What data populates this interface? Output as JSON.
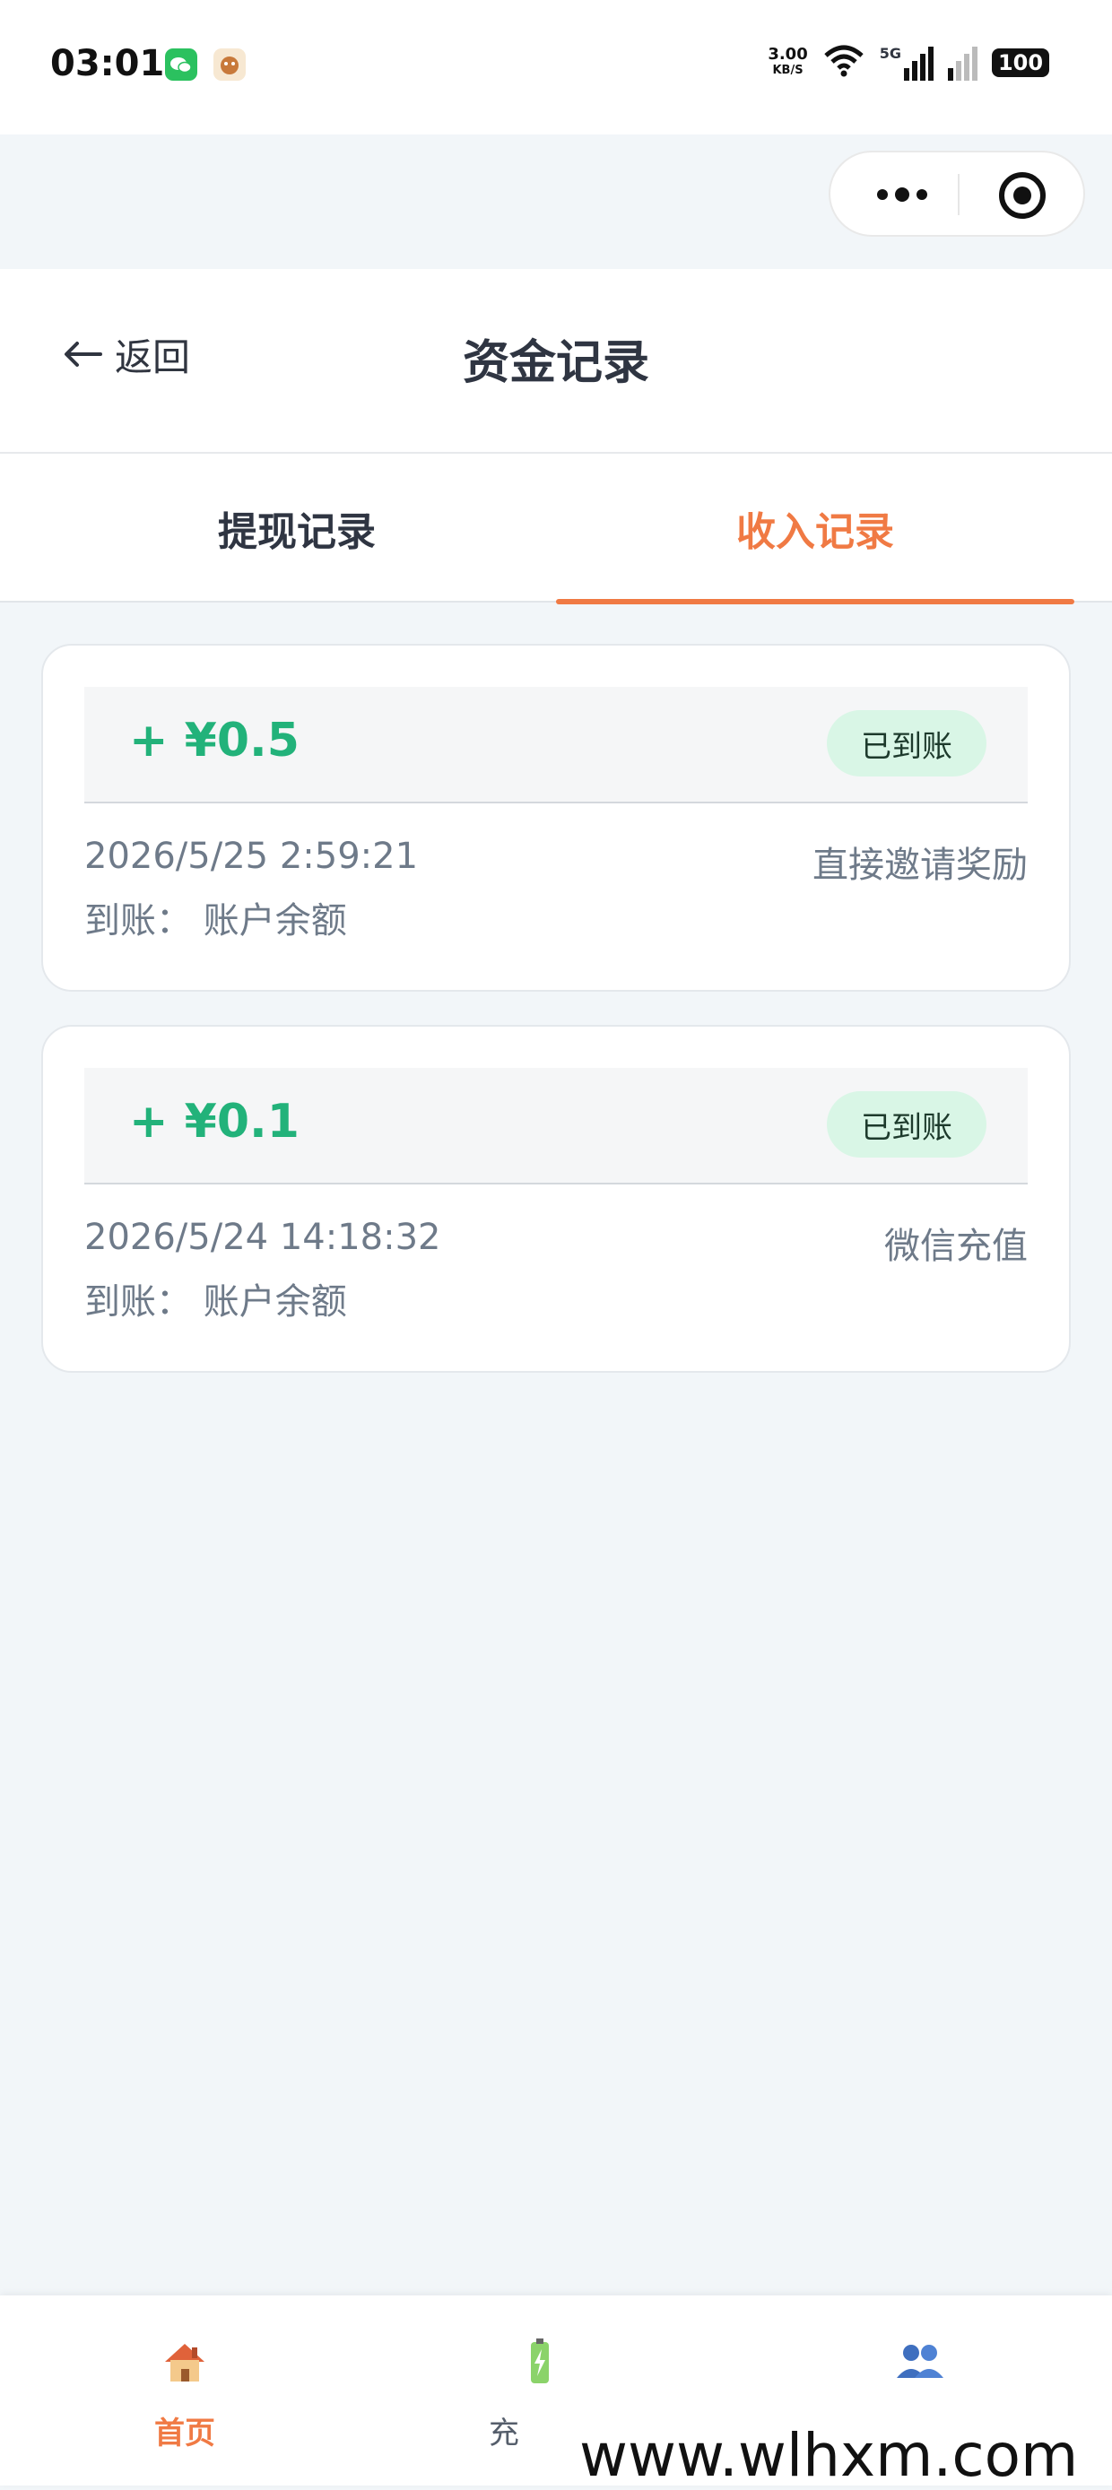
{
  "status_bar": {
    "time": "03:01",
    "net_speed_value": "3.00",
    "net_speed_unit": "KB/S",
    "signal_label": "5G",
    "battery": "100"
  },
  "nav": {
    "back_label": "返回",
    "title": "资金记录"
  },
  "tabs": [
    {
      "label": "提现记录",
      "active": false
    },
    {
      "label": "收入记录",
      "active": true
    }
  ],
  "records": [
    {
      "amount": "+ ¥0.5",
      "status": "已到账",
      "time": "2026/5/25 2:59:21",
      "source": "直接邀请奖励",
      "destination": "到账：  账户余额"
    },
    {
      "amount": "+ ¥0.1",
      "status": "已到账",
      "time": "2026/5/24 14:18:32",
      "source": "微信充值",
      "destination": "到账：  账户余额"
    }
  ],
  "bottom_nav": [
    {
      "label": "首页",
      "icon": "house-icon",
      "active": true
    },
    {
      "label": "充",
      "icon": "battery-icon",
      "active": false
    },
    {
      "label": "",
      "icon": "users-icon",
      "active": false
    }
  ],
  "watermark": "www.wlhxm.com",
  "colors": {
    "accent": "#f07a44",
    "amount_green": "#22b27a",
    "status_bg": "#d9f6e6",
    "page_bg": "#f2f6f9"
  }
}
